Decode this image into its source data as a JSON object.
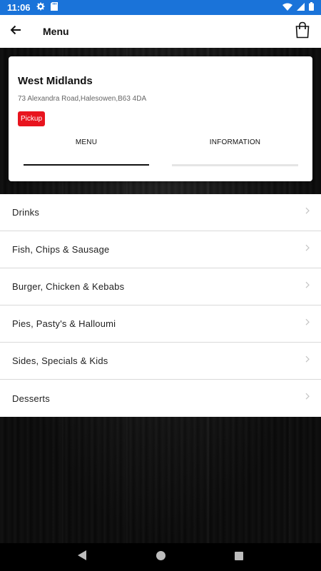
{
  "status_bar": {
    "time": "11:06",
    "icons": [
      "settings-icon",
      "sd-card-icon",
      "wifi-icon",
      "signal-icon",
      "battery-icon"
    ]
  },
  "app_bar": {
    "title": "Menu",
    "back_icon": "arrow-left-icon",
    "bag_icon": "shopping-bag-icon"
  },
  "store": {
    "name": "West Midlands",
    "address": "73 Alexandra Road,Halesowen,B63 4DA",
    "badge": "Pickup",
    "badge_color": "#e8141e"
  },
  "tabs": [
    {
      "label": "MENU",
      "active": true
    },
    {
      "label": "INFORMATION",
      "active": false
    }
  ],
  "categories": [
    {
      "label": "Drinks"
    },
    {
      "label": "Fish, Chips & Sausage"
    },
    {
      "label": "Burger, Chicken & Kebabs"
    },
    {
      "label": "Pies, Pasty's & Halloumi"
    },
    {
      "label": "Sides, Specials & Kids"
    },
    {
      "label": "Desserts"
    }
  ],
  "nav_bar": {
    "icons": [
      "back-triangle-icon",
      "home-circle-icon",
      "recents-square-icon"
    ]
  },
  "colors": {
    "status_bar": "#1a73d9",
    "accent": "#e8141e"
  }
}
